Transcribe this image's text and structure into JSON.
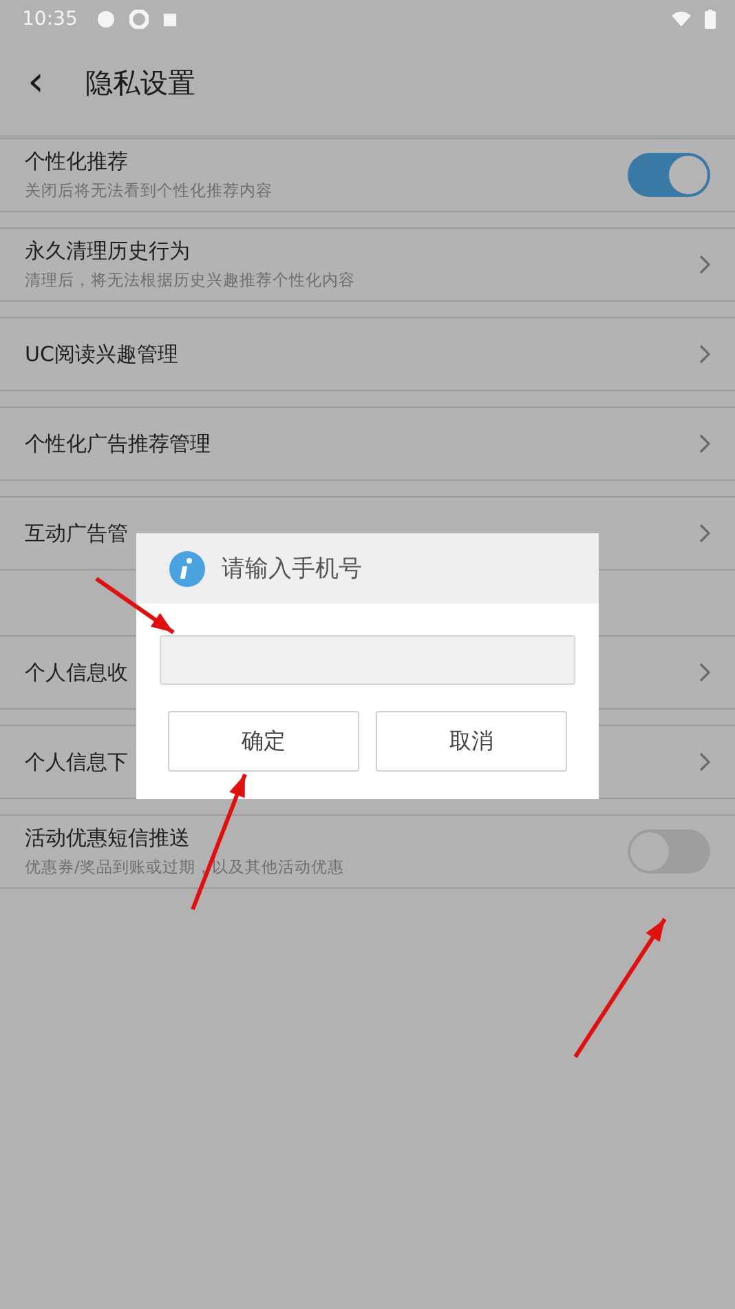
{
  "status_bar": {
    "time": "10:35"
  },
  "header": {
    "back": "‹",
    "title": "隐私设置"
  },
  "items": [
    {
      "kind": "toggle",
      "title": "个性化推荐",
      "subtitle": "关闭后将无法看到个性化推荐内容",
      "on": true
    },
    {
      "kind": "link",
      "title": "永久清理历史行为",
      "subtitle": "清理后，将无法根据历史兴趣推荐个性化内容"
    },
    {
      "kind": "link",
      "title": "UC阅读兴趣管理"
    },
    {
      "kind": "link",
      "title": "个性化广告推荐管理"
    },
    {
      "kind": "link",
      "title": "互动广告管"
    },
    {
      "kind": "spacer"
    },
    {
      "kind": "link",
      "title": "个人信息收"
    },
    {
      "kind": "link",
      "title": "个人信息下"
    },
    {
      "kind": "toggle",
      "title": "活动优惠短信推送",
      "subtitle": "优惠券/奖品到账或过期，以及其他活动优惠",
      "on": false
    }
  ],
  "dialog": {
    "title": "请输入手机号",
    "buttons": [
      "确定",
      "取消"
    ]
  }
}
